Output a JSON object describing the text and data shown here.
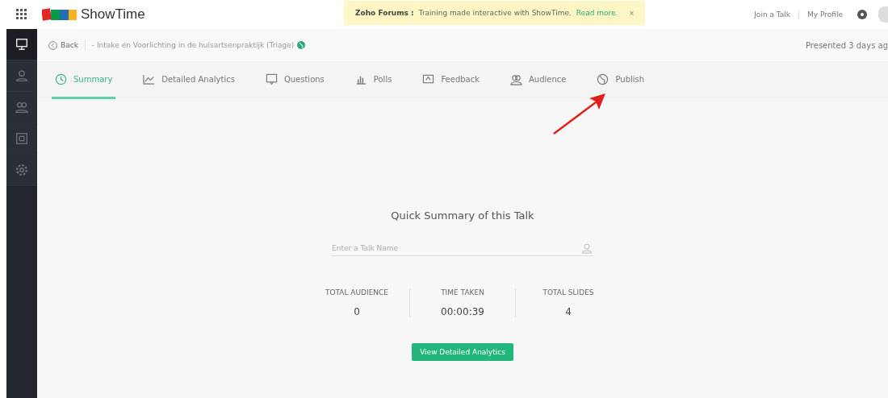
{
  "header": {
    "app_name": "ShowTime",
    "notice": {
      "title": "Zoho Forums :",
      "text": "Training made interactive with ShowTime.",
      "link": "Read more.",
      "close": "×"
    },
    "links": [
      "Join a Talk",
      "My Profile"
    ]
  },
  "sidebar": {
    "items": [
      {
        "selected": true
      },
      {
        "selected": false
      },
      {
        "selected": false
      },
      {
        "selected": false
      },
      {
        "selected": false
      }
    ]
  },
  "breadcrumb": {
    "back": "Back",
    "talk_title": "- Intake en Voorlichting in de huisartsenpraktijk (Triage)",
    "status": "Presented 3 days ag"
  },
  "tabs": [
    {
      "label": "Summary",
      "selected": true
    },
    {
      "label": "Detailed Analytics",
      "selected": false
    },
    {
      "label": "Questions",
      "selected": false
    },
    {
      "label": "Polls",
      "selected": false
    },
    {
      "label": "Feedback",
      "selected": false
    },
    {
      "label": "Audience",
      "selected": false
    },
    {
      "label": "Publish",
      "selected": false
    }
  ],
  "summary": {
    "title": "Quick Summary of this Talk",
    "name_field": {
      "placeholder": "Enter a Talk Name"
    },
    "stats": [
      {
        "label": "TOTAL AUDIENCE",
        "value": "0"
      },
      {
        "label": "TIME TAKEN",
        "value": "00:00:39"
      },
      {
        "label": "TOTAL SLIDES",
        "value": "4"
      }
    ],
    "button": "View Detailed Analytics"
  }
}
